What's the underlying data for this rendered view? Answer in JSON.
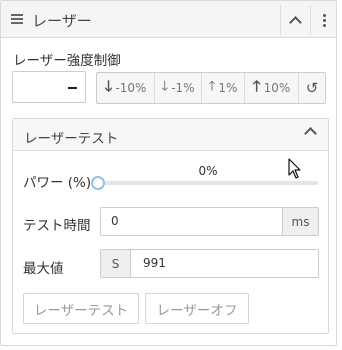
{
  "panel": {
    "title": "レーザー",
    "icons": {
      "menu": "hamburger-icon",
      "collapse": "chevron-up-icon",
      "more": "more-vertical-icon"
    }
  },
  "laser_power": {
    "label": "レーザー強度制御",
    "value": "–",
    "steps": [
      {
        "icon": "arrow-down-icon",
        "label": "-10%"
      },
      {
        "icon": "arrow-down-icon",
        "label": "-1%"
      },
      {
        "icon": "arrow-up-icon",
        "label": "1%"
      },
      {
        "icon": "arrow-up-icon",
        "label": "10%"
      }
    ],
    "reset_icon": "reset-icon"
  },
  "laser_test": {
    "title": "レーザーテスト",
    "power": {
      "label": "パワー (%)",
      "value": "0%",
      "level": 0
    },
    "test_time": {
      "label": "テスト時間",
      "value": "0",
      "unit": "ms"
    },
    "max_value": {
      "label": "最大値",
      "prefix": "S",
      "value": "991"
    },
    "buttons": {
      "test": "レーザーテスト",
      "off": "レーザーオフ"
    }
  }
}
